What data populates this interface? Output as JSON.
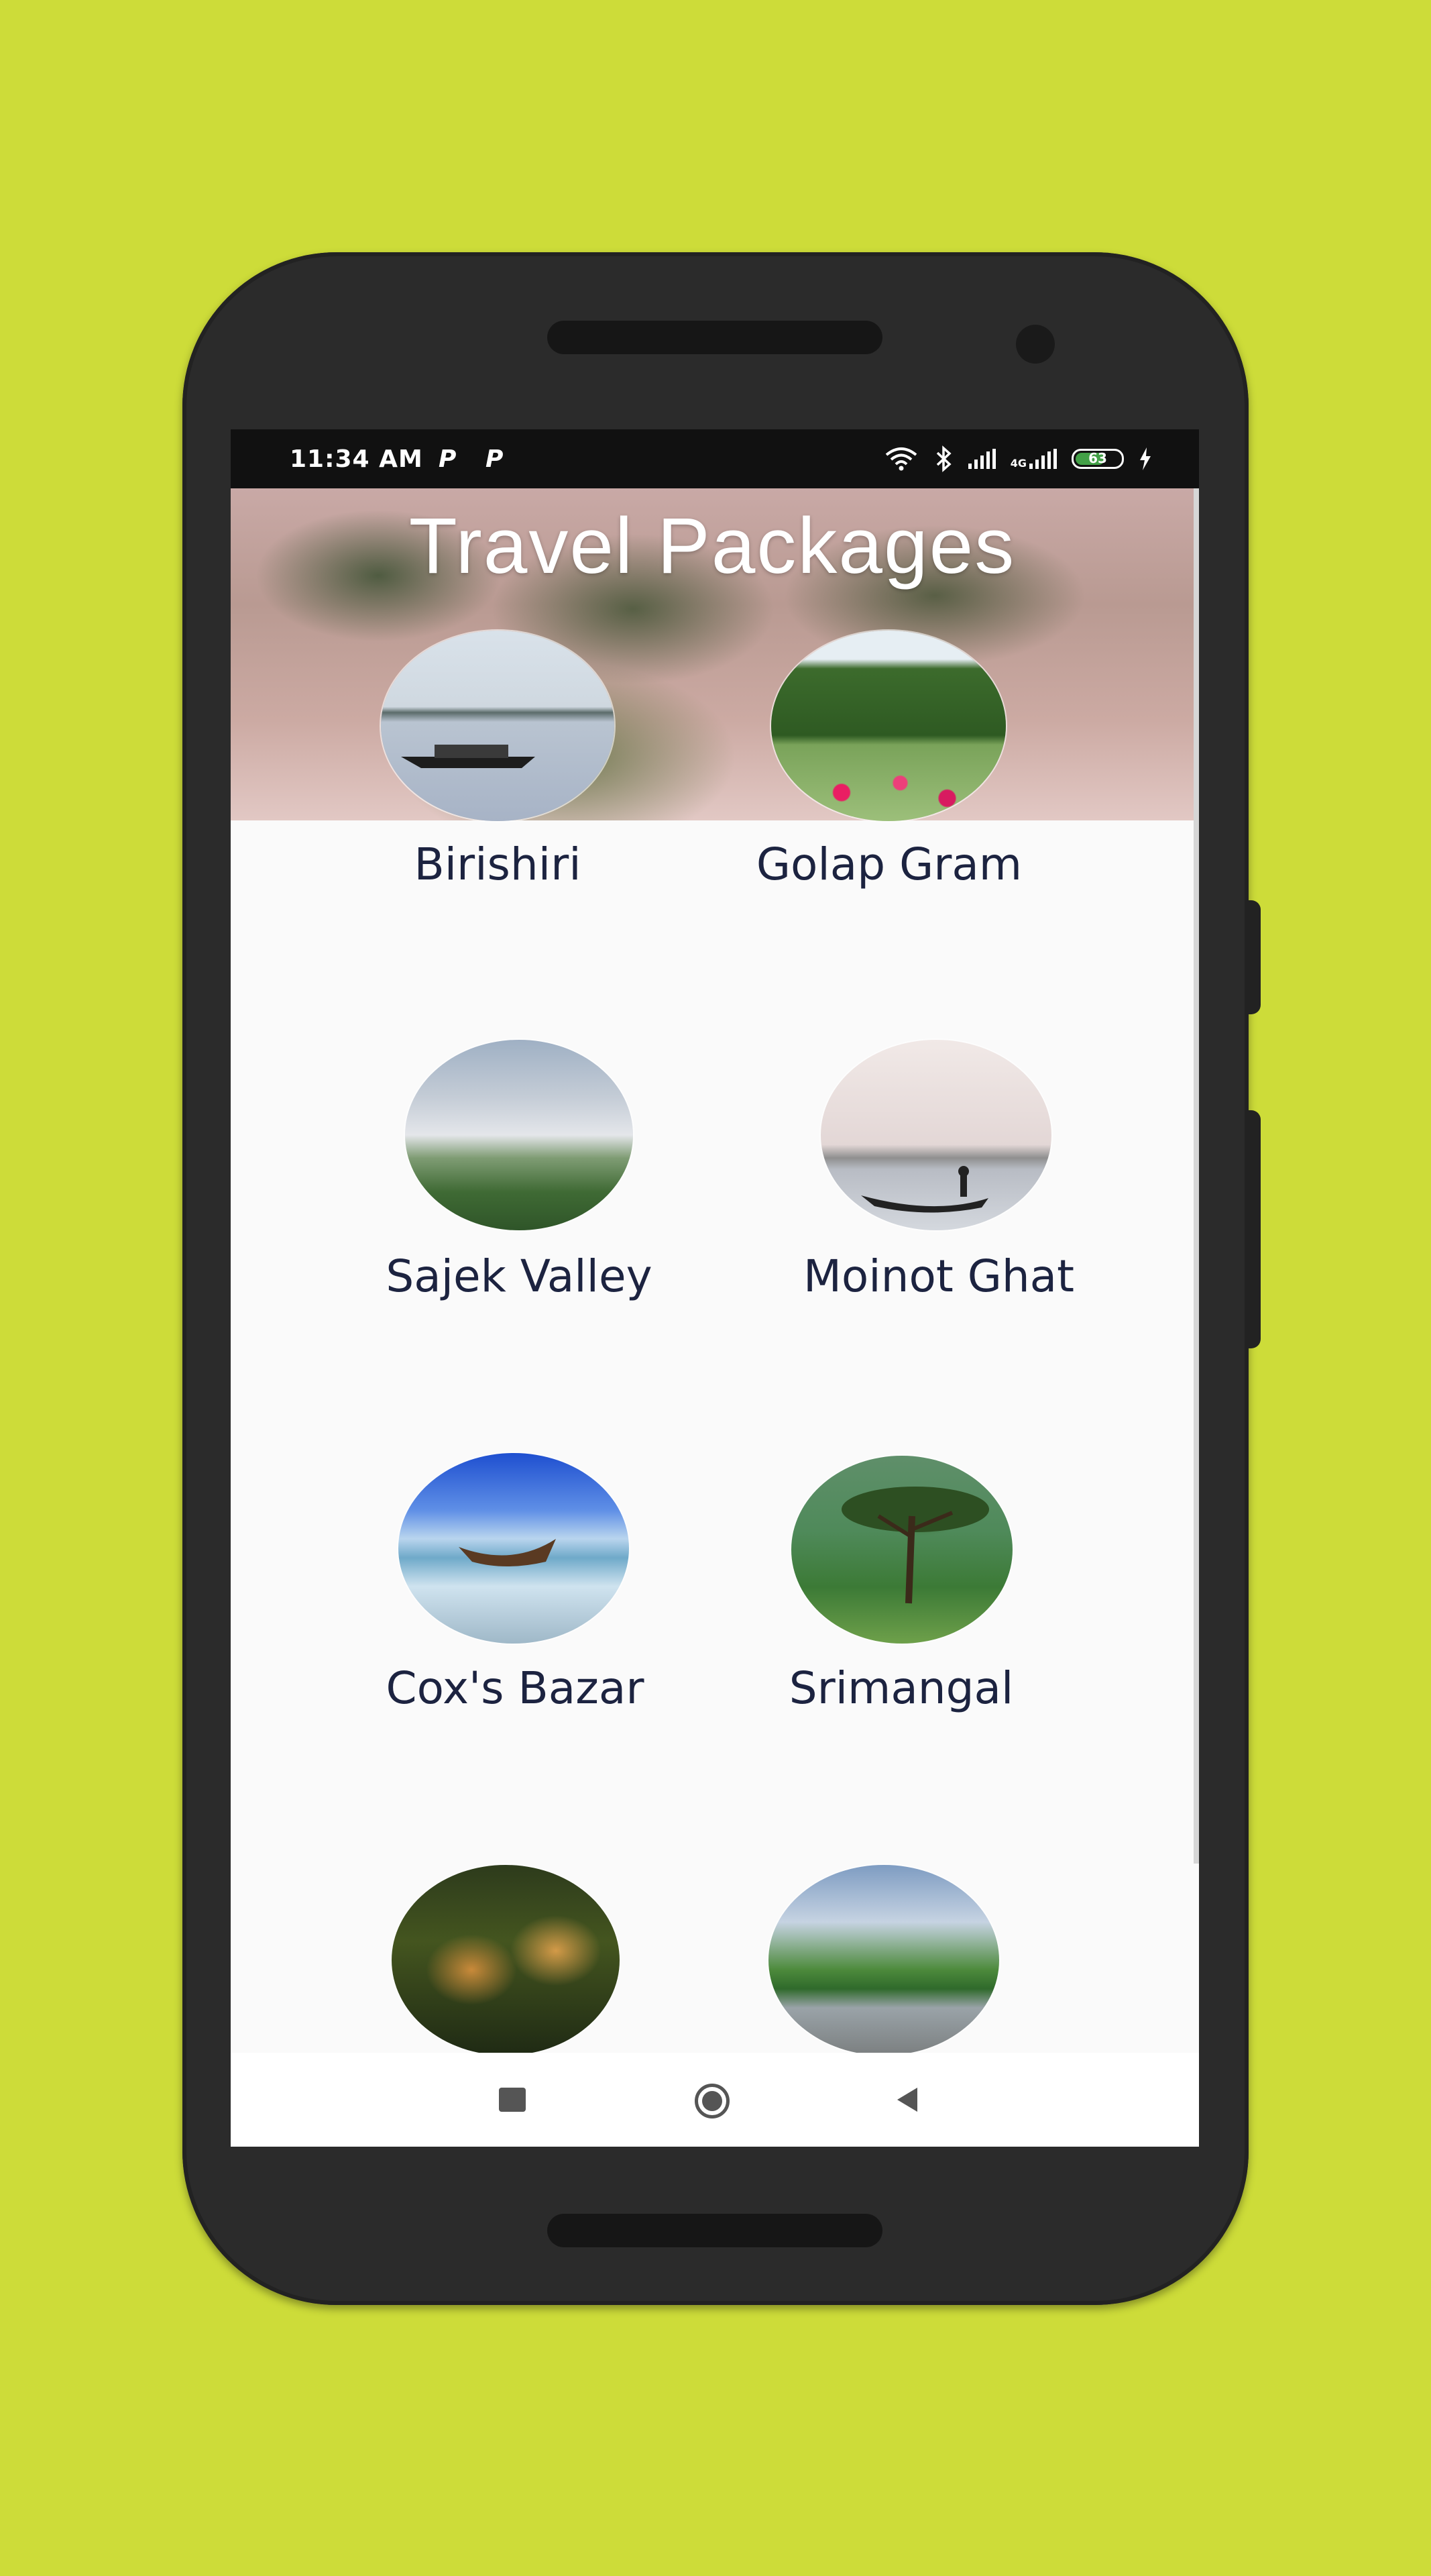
{
  "status_bar": {
    "time": "11:34 AM",
    "notification_icons": [
      "P",
      "P"
    ],
    "network_label": "4G",
    "battery_level": "63",
    "icons": [
      "wifi-icon",
      "bluetooth-icon",
      "signal-icon",
      "signal-4g-icon",
      "battery-icon",
      "charging-icon"
    ]
  },
  "header": {
    "title": "Travel Packages"
  },
  "packages": [
    {
      "label": "Birishiri",
      "image": "boat-on-lake"
    },
    {
      "label": "Golap Gram",
      "image": "rose-garden"
    },
    {
      "label": "Sajek Valley",
      "image": "misty-hills"
    },
    {
      "label": "Moinot Ghat",
      "image": "boat-silhouette"
    },
    {
      "label": "Cox's Bazar",
      "image": "beach-boat"
    },
    {
      "label": "Srimangal",
      "image": "tea-garden-tree"
    },
    {
      "label": "",
      "image": "tigers"
    },
    {
      "label": "",
      "image": "river-valley"
    }
  ],
  "nav_bar": {
    "icons": [
      "recents-icon",
      "home-icon",
      "back-icon"
    ]
  },
  "colors": {
    "background": "#cddc39",
    "phone_body": "#2b2b2b",
    "label_text": "#1c2340"
  }
}
